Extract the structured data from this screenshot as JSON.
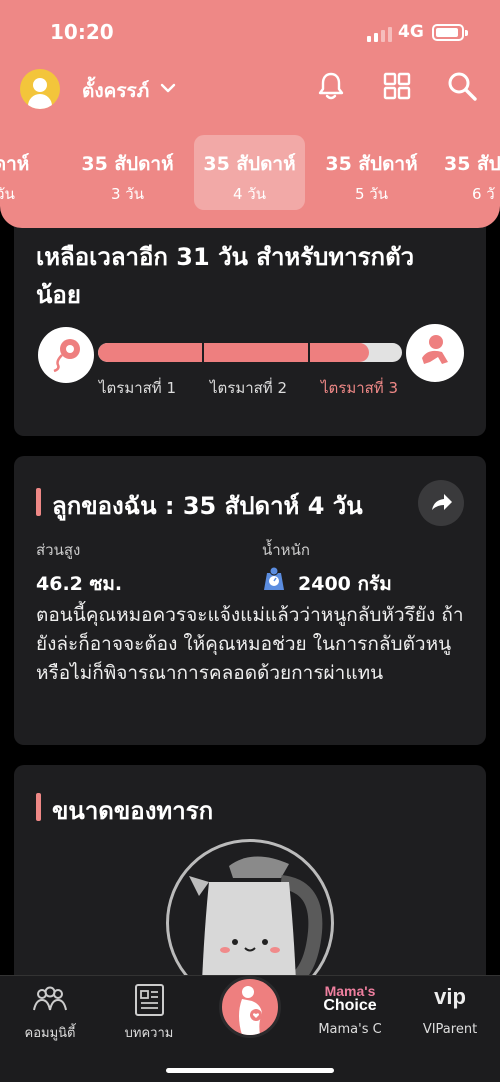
{
  "status": {
    "time": "10:20",
    "network": "4G"
  },
  "header": {
    "profile_name": "ตั้งครรภ์",
    "week_tabs": [
      {
        "week": "ปดาห์",
        "day": "วัน"
      },
      {
        "week": "35 สัปดาห์",
        "day": "3 วัน"
      },
      {
        "week": "35 สัปดาห์",
        "day": "4 วัน"
      },
      {
        "week": "35 สัปดาห์",
        "day": "5 วัน"
      },
      {
        "week": "35 สัป",
        "day": "6 วั"
      }
    ],
    "active_tab": 2
  },
  "countdown": {
    "text": "เหลือเวลาอีก 31 วัน สำหรับทารกตัวน้อย",
    "progress": 0.89,
    "trimesters": [
      "ไตรมาสที่ 1",
      "ไตรมาสที่ 2",
      "ไตรมาสที่ 3"
    ],
    "active_trimester": 3
  },
  "baby_card": {
    "title": "ลูกของฉัน : 35 สัปดาห์ 4  วัน",
    "height_label": "ส่วนสูง",
    "height_value": "46.2 ซม.",
    "weight_label": "น้ำหนัก",
    "weight_value": "2400 กรัม",
    "description": "ตอนนี้คุณหมอควรจะแจ้งแม่แล้วว่าหนูกลับหัวรึยัง ถ้ายังล่ะก็อาจจะต้อง ให้คุณหมอช่วย ในการกลับตัวหนูหรือไม่ก็พิจารณาการคลอดด้วยการผ่าแทน"
  },
  "size_card": {
    "title": "ขนาดของทารก"
  },
  "bottom_nav": {
    "items": [
      {
        "label": "คอมมูนิตี้",
        "icon": "community-icon"
      },
      {
        "label": "บทความ",
        "icon": "article-icon"
      },
      {
        "label": "",
        "icon": "pregnancy-icon"
      },
      {
        "label": "Mama's C",
        "icon": "mamas-choice-logo",
        "brand_top": "Mama's",
        "brand_bottom": "Choice"
      },
      {
        "label": "VIParent",
        "icon": "vip-logo",
        "brand_top": "vip"
      }
    ]
  },
  "colors": {
    "accent": "#ee8886",
    "card": "#1e1e20",
    "background": "#000000"
  }
}
